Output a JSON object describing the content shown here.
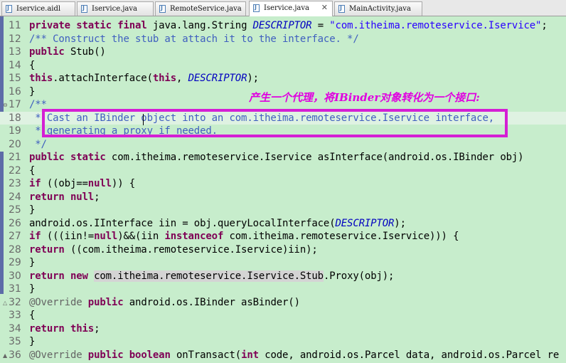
{
  "tabs": [
    {
      "label": "Iservice.aidl"
    },
    {
      "label": "Iservice.java"
    },
    {
      "label": "RemoteService.java"
    },
    {
      "label": "Iservice.java",
      "active": true,
      "close": "✕"
    },
    {
      "label": "MainActivity.java"
    }
  ],
  "editor": {
    "lines": [
      {
        "n": "11"
      },
      {
        "n": "12"
      },
      {
        "n": "13"
      },
      {
        "n": "14"
      },
      {
        "n": "15"
      },
      {
        "n": "16"
      },
      {
        "n": "17"
      },
      {
        "n": "18"
      },
      {
        "n": "19"
      },
      {
        "n": "20"
      },
      {
        "n": "21"
      },
      {
        "n": "22"
      },
      {
        "n": "23"
      },
      {
        "n": "24"
      },
      {
        "n": "25"
      },
      {
        "n": "26"
      },
      {
        "n": "27"
      },
      {
        "n": "28"
      },
      {
        "n": "29"
      },
      {
        "n": "30"
      },
      {
        "n": "31"
      },
      {
        "n": "32"
      },
      {
        "n": "33"
      },
      {
        "n": "34"
      },
      {
        "n": "35"
      },
      {
        "n": "36"
      }
    ]
  },
  "annotation": {
    "callout_text": "产生一个代理，将IBinder对象转化为一个接口:",
    "color": "#d41fd4"
  },
  "colors": {
    "background": "#c7edcc",
    "keyword": "#7f0055",
    "string": "#2a00ff",
    "comment": "#3f5fbf"
  }
}
